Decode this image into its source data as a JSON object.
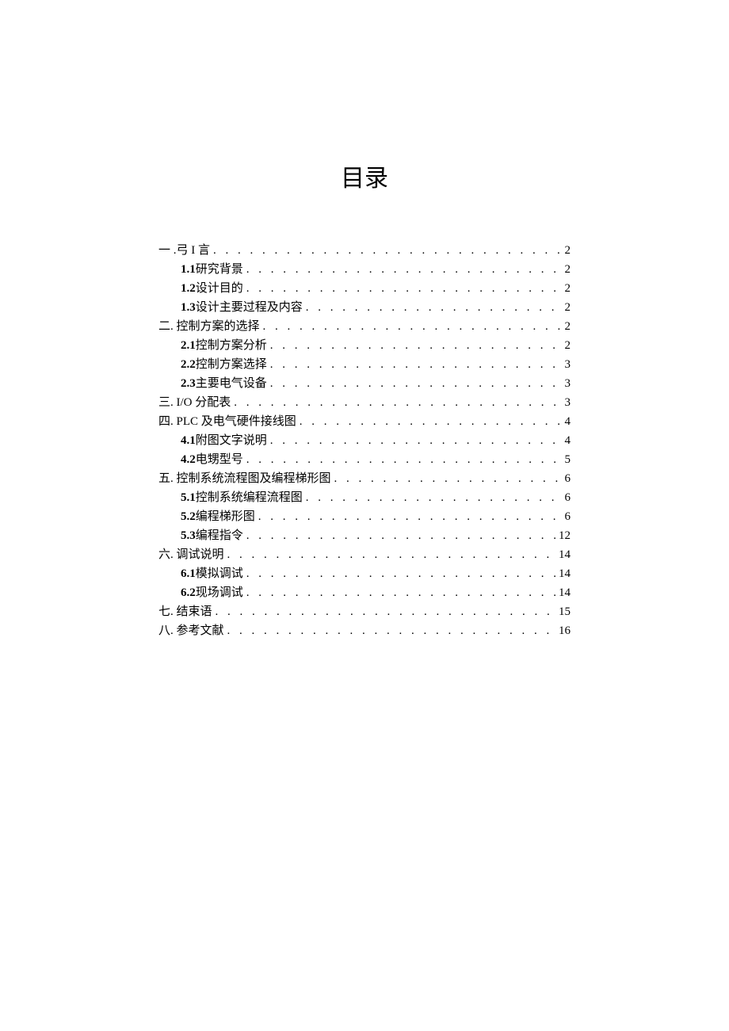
{
  "title": "目录",
  "entries": [
    {
      "level": 1,
      "num": "一 .",
      "label": "弓 I 言",
      "page": "2"
    },
    {
      "level": 2,
      "num": "1.1",
      "label": "研究背景",
      "page": "2"
    },
    {
      "level": 2,
      "num": "1.2",
      "label": "设计目的",
      "page": "2"
    },
    {
      "level": 2,
      "num": "1.3",
      "label": "设计主要过程及内容",
      "page": "2"
    },
    {
      "level": 1,
      "num": "二",
      "label": ". 控制方案的选择",
      "page": "2"
    },
    {
      "level": 2,
      "num": "2.1",
      "label": "控制方案分析",
      "page": "2"
    },
    {
      "level": 2,
      "num": "2.2",
      "label": "控制方案选择",
      "page": "3"
    },
    {
      "level": 2,
      "num": "2.3",
      "label": "主要电气设备",
      "page": "3"
    },
    {
      "level": 1,
      "num": "三",
      "label": ". I/O 分配表",
      "page": "3"
    },
    {
      "level": 1,
      "num": "四",
      "label": ". PLC 及电气硬件接线图",
      "page": "4"
    },
    {
      "level": 2,
      "num": "4.1",
      "label": "附图文字说明",
      "page": "4"
    },
    {
      "level": 2,
      "num": "4.2",
      "label": "电甥型号",
      "page": "5"
    },
    {
      "level": 1,
      "num": "五",
      "label": ". 控制系统流程图及编程梯形图",
      "page": "6"
    },
    {
      "level": 2,
      "num": "5.1",
      "label": "控制系统编程流程图",
      "page": "6"
    },
    {
      "level": 2,
      "num": "5.2",
      "label": "编程梯形图",
      "page": "6"
    },
    {
      "level": 2,
      "num": "5.3",
      "label": "编程指令",
      "page": "12"
    },
    {
      "level": 1,
      "num": "六",
      "label": ". 调试说明",
      "page": "14"
    },
    {
      "level": 2,
      "num": "6.1",
      "label": "模拟调试",
      "page": "14"
    },
    {
      "level": 2,
      "num": "6.2",
      "label": "现场调试",
      "page": "14"
    },
    {
      "level": 1,
      "num": "七",
      "label": ". 结束语",
      "page": "15"
    },
    {
      "level": 1,
      "num": "八",
      "label": ". 参考文献",
      "page": "16"
    }
  ]
}
